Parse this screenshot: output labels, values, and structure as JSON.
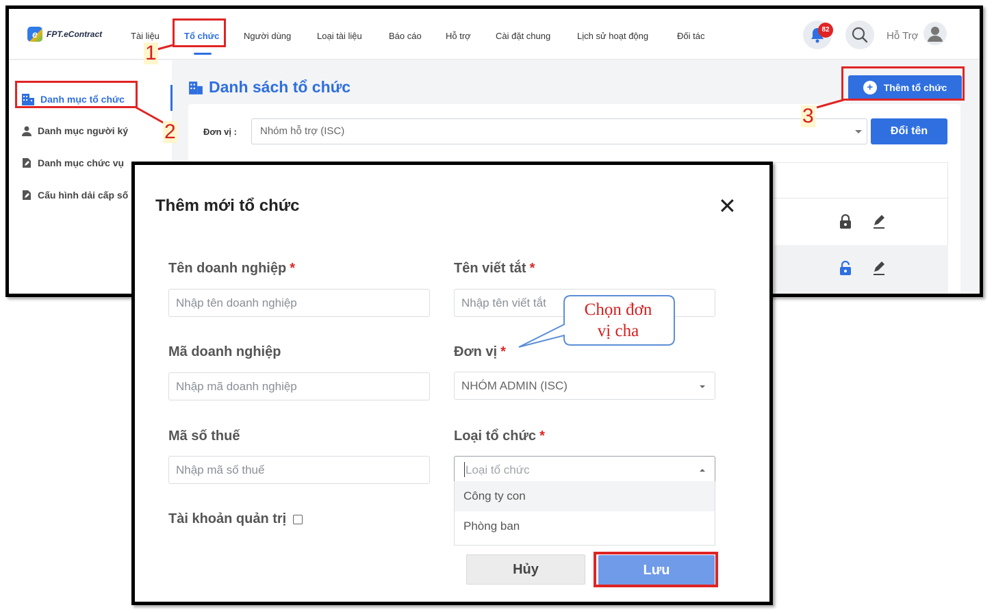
{
  "app": {
    "logo_text": "FPT.eContract",
    "logo_mark": "e",
    "nav": [
      "Tài liệu",
      "Tổ chức",
      "Người dùng",
      "Loại tài liệu",
      "Báo cáo",
      "Hỗ trợ",
      "Cài đặt chung",
      "Lịch sử hoạt động",
      "Đối tác"
    ],
    "active_nav": "Tổ chức",
    "notification_count": "82",
    "support_label": "Hỗ Trợ",
    "sidebar": [
      "Danh mục tổ chức",
      "Danh mục người ký",
      "Danh mục chức vụ",
      "Cấu hình dải cấp số"
    ],
    "page_title": "Danh sách tổ chức",
    "add_org_label": "Thêm tổ chức",
    "unit_label": "Đơn vị :",
    "unit_value": "Nhóm hỗ trợ (ISC)",
    "rename_label": "Đổi tên"
  },
  "modal": {
    "title": "Thêm mới tổ chức",
    "close_symbol": "✕",
    "fields": {
      "company_name": {
        "label": "Tên doanh nghiệp",
        "required": "*",
        "placeholder": "Nhập tên doanh nghiệp"
      },
      "short_name": {
        "label": "Tên viết tắt",
        "required": "*",
        "placeholder": "Nhập tên viết tắt"
      },
      "company_code": {
        "label": "Mã doanh nghiệp",
        "placeholder": "Nhập mã doanh nghiệp"
      },
      "unit": {
        "label": "Đơn vị",
        "required": "*",
        "value": "NHÓM ADMIN (ISC)"
      },
      "tax_code": {
        "label": "Mã số thuế",
        "placeholder": "Nhập mã số thuế"
      },
      "org_type": {
        "label": "Loại tổ chức",
        "required": "*",
        "placeholder": "Loại tổ chức",
        "options": [
          "Công ty con",
          "Phòng ban"
        ]
      },
      "admin_account": {
        "label": "Tài khoản quản trị",
        "checked": false
      }
    },
    "cancel_label": "Hủy",
    "save_label": "Lưu"
  },
  "annotations": {
    "steps": [
      "1",
      "2",
      "3"
    ],
    "callout": "Chọn đơn vị cha",
    "callout_line1": "Chọn đơn",
    "callout_line2": "vị cha",
    "highlight_color": "#e02424"
  }
}
